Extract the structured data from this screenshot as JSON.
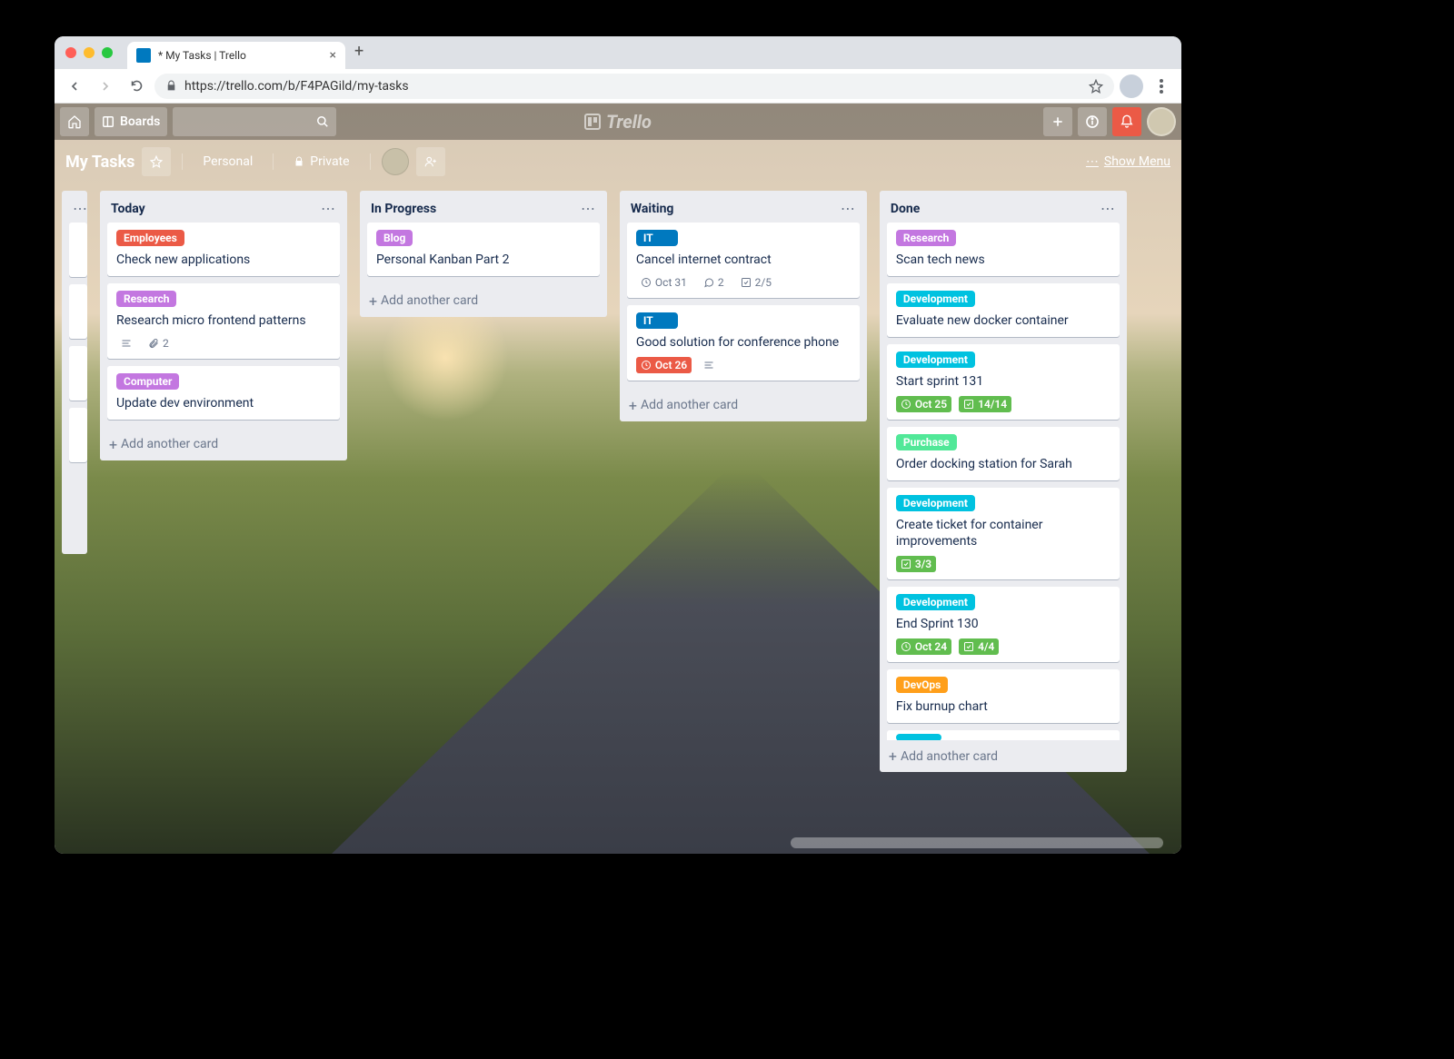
{
  "chrome": {
    "tab_title": "* My Tasks | Trello",
    "url": "https://trello.com/b/F4PAGild/my-tasks"
  },
  "header": {
    "boards_label": "Boards",
    "logo": "Trello"
  },
  "board": {
    "title": "My Tasks",
    "team": "Personal",
    "visibility": "Private",
    "show_menu": "Show Menu"
  },
  "labels": {
    "employees": {
      "text": "Employees",
      "color": "#eb5a46"
    },
    "research": {
      "text": "Research",
      "color": "#c377e0"
    },
    "computer": {
      "text": "Computer",
      "color": "#c377e0"
    },
    "blog": {
      "text": "Blog",
      "color": "#c377e0"
    },
    "it": {
      "text": "IT",
      "color": "#0079bf"
    },
    "development": {
      "text": "Development",
      "color": "#00c2e0"
    },
    "purchase": {
      "text": "Purchase",
      "color": "#51e898"
    },
    "devops": {
      "text": "DevOps",
      "color": "#ff9f1a"
    }
  },
  "lists": {
    "today": {
      "title": "Today",
      "add": "Add another card",
      "c0": {
        "title": "Check new applications"
      },
      "c1": {
        "title": "Research micro frontend patterns",
        "attach": "2"
      },
      "c2": {
        "title": "Update dev environment"
      }
    },
    "in_progress": {
      "title": "In Progress",
      "add": "Add another card",
      "c0": {
        "title": "Personal Kanban Part 2"
      }
    },
    "waiting": {
      "title": "Waiting",
      "add": "Add another card",
      "c0": {
        "title": "Cancel internet contract",
        "due": "Oct 31",
        "comments": "2",
        "check": "2/5"
      },
      "c1": {
        "title": "Good solution for conference phone",
        "due": "Oct 26"
      }
    },
    "done": {
      "title": "Done",
      "add": "Add another card",
      "c0": {
        "title": "Scan tech news"
      },
      "c1": {
        "title": "Evaluate new docker container"
      },
      "c2": {
        "title": "Start sprint 131",
        "due": "Oct 25",
        "check": "14/14"
      },
      "c3": {
        "title": "Order docking station for Sarah"
      },
      "c4": {
        "title": "Create ticket for container improvements",
        "check": "3/3"
      },
      "c5": {
        "title": "End Sprint 130",
        "due": "Oct 24",
        "check": "4/4"
      },
      "c6": {
        "title": "Fix burnup chart"
      }
    }
  }
}
